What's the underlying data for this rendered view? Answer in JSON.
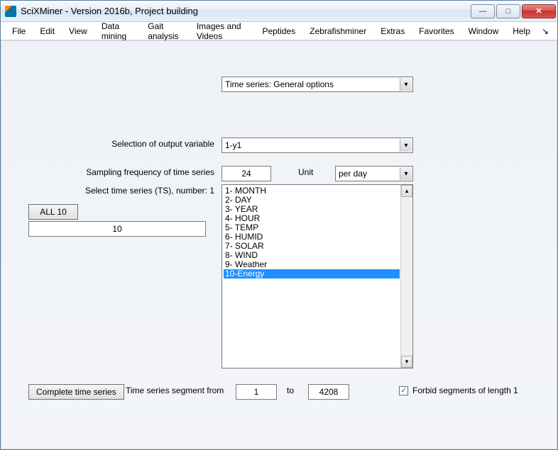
{
  "window": {
    "title": "SciXMiner - Version 2016b, Project building"
  },
  "menu": {
    "items": [
      "File",
      "Edit",
      "View",
      "Data mining",
      "Gait analysis",
      "Images and Videos",
      "Peptides",
      "Zebrafishminer",
      "Extras",
      "Favorites",
      "Window",
      "Help"
    ]
  },
  "panel": {
    "category_label": "Time series: General options",
    "output_var_label": "Selection of output variable",
    "output_var_value": "1-y1",
    "sampling_label": "Sampling frequency of time series",
    "sampling_value": "24",
    "unit_label": "Unit",
    "unit_value": "per day",
    "select_ts_label": "Select time series (TS), number: 1",
    "all_button": "ALL 10",
    "count_value": "10",
    "ts_items": [
      "1- MONTH",
      "2- DAY",
      "3- YEAR",
      "4- HOUR",
      "5- TEMP",
      "6- HUMID",
      "7- SOLAR",
      "8- WIND",
      "9- Weather",
      "10-Energy"
    ],
    "ts_selected_index": 9,
    "complete_button": "Complete time series",
    "segment_from_label": "Time series segment from",
    "segment_from_value": "1",
    "segment_to_label": "to",
    "segment_to_value": "4208",
    "forbid_checked": true,
    "forbid_label": "Forbid segments of length 1"
  }
}
